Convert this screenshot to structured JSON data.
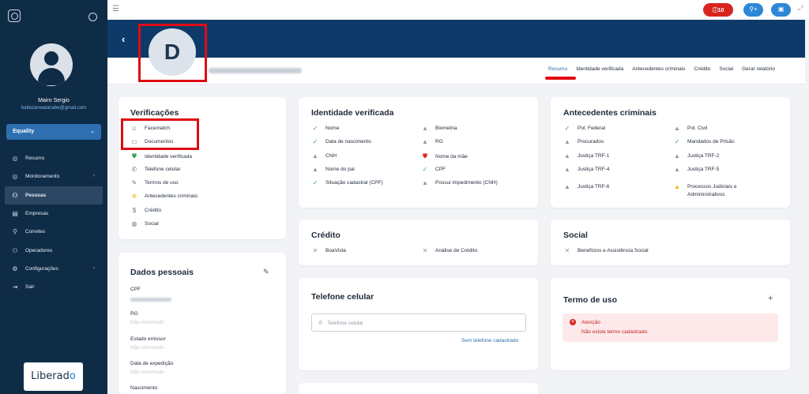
{
  "sidebar": {
    "user_name": "Mairo Sergio",
    "user_email": "baltezanwatanabe@gmail.com",
    "organization": "Equality",
    "nav": [
      {
        "label": "Resumo",
        "icon": "globe-icon",
        "arrow": false
      },
      {
        "label": "Monitoramento",
        "icon": "globe-icon",
        "arrow": true
      },
      {
        "label": "Pessoas",
        "icon": "people-icon",
        "arrow": false,
        "active": true
      },
      {
        "label": "Empresas",
        "icon": "building-icon",
        "arrow": false
      },
      {
        "label": "Convites",
        "icon": "user-add-icon",
        "arrow": false
      },
      {
        "label": "Operadores",
        "icon": "users-icon",
        "arrow": false
      },
      {
        "label": "Configurações",
        "icon": "gear-icon",
        "arrow": true
      },
      {
        "label": "Sair",
        "icon": "logout-icon",
        "arrow": false
      }
    ],
    "brand": {
      "text": "Liberad",
      "accent": "o"
    }
  },
  "topbar": {
    "alerts_count": "10"
  },
  "profile": {
    "initial": "D"
  },
  "tabs": [
    {
      "label": "Resumo",
      "active": true
    },
    {
      "label": "Identidade verificada"
    },
    {
      "label": "Antecedentes criminais"
    },
    {
      "label": "Crédito"
    },
    {
      "label": "Social"
    },
    {
      "label": "Gerar relatório"
    }
  ],
  "verificacoes": {
    "title": "Verificações",
    "items": [
      {
        "label": "Facematch",
        "icon": "face-icon"
      },
      {
        "label": "Documentos",
        "icon": "document-icon"
      },
      {
        "label": "Identidade verificada",
        "icon": "shield-check-icon"
      },
      {
        "label": "Telefone celular",
        "icon": "phone-icon"
      },
      {
        "label": "Termos de uso",
        "icon": "pen-icon"
      },
      {
        "label": "Antecedentes criminais",
        "icon": "badge-icon"
      },
      {
        "label": "Crédito",
        "icon": "dollar-icon"
      },
      {
        "label": "Social",
        "icon": "globe-icon"
      }
    ]
  },
  "identidade": {
    "title": "Identidade verificada",
    "left": [
      {
        "label": "Nome",
        "status": "ok"
      },
      {
        "label": "Data de nascimento",
        "status": "ok"
      },
      {
        "label": "CNH",
        "status": "warn"
      },
      {
        "label": "Nome do pai",
        "status": "warn"
      },
      {
        "label": "Situação cadastral (CPF)",
        "status": "ok"
      }
    ],
    "right": [
      {
        "label": "Biometria",
        "status": "warn"
      },
      {
        "label": "RG",
        "status": "warn"
      },
      {
        "label": "Nome da mãe",
        "status": "error"
      },
      {
        "label": "CPF",
        "status": "ok"
      },
      {
        "label": "Possui impedimento (CNH)",
        "status": "warn"
      }
    ]
  },
  "antecedentes": {
    "title": "Antecedentes criminais",
    "left": [
      {
        "label": "Pol. Federal",
        "status": "ok"
      },
      {
        "label": "Procurados",
        "status": "warn"
      },
      {
        "label": "Justiça TRF-1",
        "status": "warn"
      },
      {
        "label": "Justiça TRF-4",
        "status": "warn"
      },
      {
        "label": "Justiça TRF-6",
        "status": "warn"
      }
    ],
    "right": [
      {
        "label": "Pol. Civil",
        "status": "warn"
      },
      {
        "label": "Mandados de Prisão",
        "status": "ok"
      },
      {
        "label": "Justiça TRF-2",
        "status": "warn"
      },
      {
        "label": "Justiça TRF-5",
        "status": "warn"
      },
      {
        "label": "Processos Judiciais e",
        "label2": "Admininstrativos",
        "status": "warn-y"
      }
    ]
  },
  "credito": {
    "title": "Crédito",
    "items": [
      "BoaVista",
      "Análise de Crédito"
    ]
  },
  "social": {
    "title": "Social",
    "items": [
      "Benefícios e Assistência Social"
    ]
  },
  "dados": {
    "title": "Dados pessoais",
    "fields": [
      {
        "label": "CPF",
        "value": "",
        "blurred": true
      },
      {
        "label": "RG",
        "value": "Não informado"
      },
      {
        "label": "Estado emissor",
        "value": "Não informado"
      },
      {
        "label": "Data de expedição",
        "value": "Não informado"
      },
      {
        "label": "Nascimento",
        "value": ""
      }
    ]
  },
  "telefone": {
    "title": "Telefone celular",
    "placeholder": "Telefone celular",
    "link": "Sem telefone cadastrado"
  },
  "termo": {
    "title": "Termo de uso",
    "alert_title": "Atenção",
    "alert_msg": "Não existe termo cadastrado."
  }
}
